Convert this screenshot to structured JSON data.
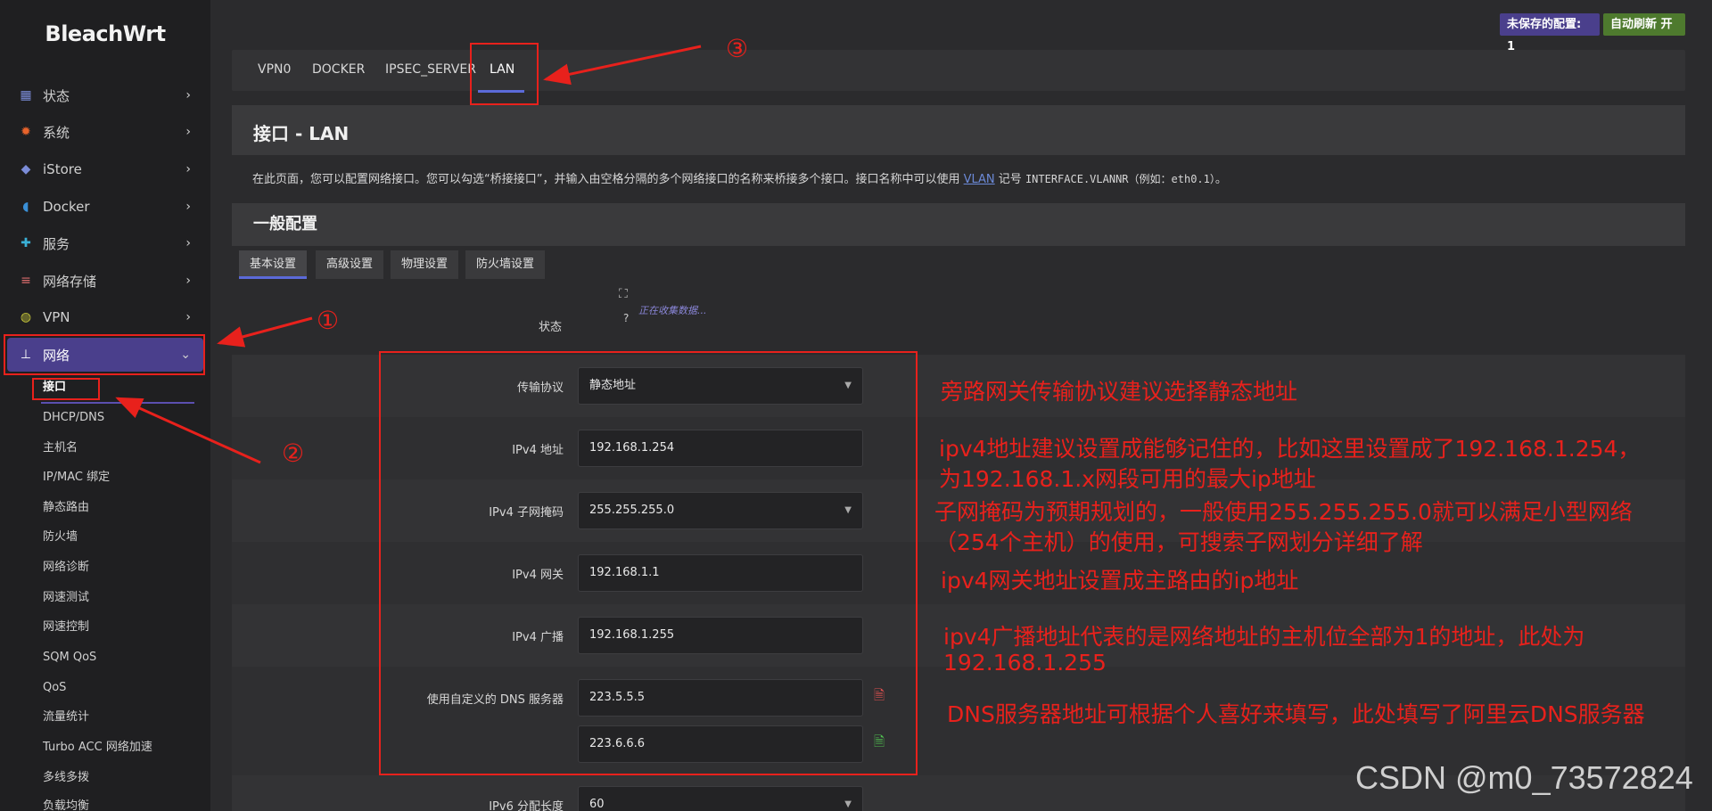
{
  "brand": "BleachWrt",
  "badges": {
    "unsaved": "未保存的配置: 1",
    "refresh": "自动刷新 开"
  },
  "sidebar": {
    "items": [
      {
        "label": "状态",
        "icon": "dashboard-icon"
      },
      {
        "label": "系统",
        "icon": "gear-icon"
      },
      {
        "label": "iStore",
        "icon": "cube-icon"
      },
      {
        "label": "Docker",
        "icon": "docker-icon"
      },
      {
        "label": "服务",
        "icon": "puzzle-icon"
      },
      {
        "label": "网络存储",
        "icon": "database-icon"
      },
      {
        "label": "VPN",
        "icon": "vpn-icon"
      },
      {
        "label": "网络",
        "icon": "network-icon"
      }
    ],
    "subitems": [
      "接口",
      "DHCP/DNS",
      "主机名",
      "IP/MAC 绑定",
      "静态路由",
      "防火墙",
      "网络诊断",
      "网速测试",
      "网速控制",
      "SQM QoS",
      "QoS",
      "流量统计",
      "Turbo ACC 网络加速",
      "多线多拨",
      "负载均衡"
    ]
  },
  "tabs": [
    "VPN0",
    "DOCKER",
    "IPSEC_SERVER",
    "LAN"
  ],
  "page": {
    "title": "接口 - LAN",
    "desc_pre": "在此页面，您可以配置网络接口。您可以勾选“桥接接口”，并输入由空格分隔的多个网络接口的名称来桥接多个接口。接口名称中可以使用 ",
    "desc_link": "VLAN",
    "desc_mid": " 记号 ",
    "desc_code": "INTERFACE.VLANNR（例如：eth0.1）",
    "desc_post": "。",
    "section": "一般配置",
    "subtabs": [
      "基本设置",
      "高级设置",
      "物理设置",
      "防火墙设置"
    ]
  },
  "form": {
    "status_label": "状态",
    "status_q": "?",
    "status_text": "正在收集数据...",
    "protocol_label": "传输协议",
    "protocol_value": "静态地址",
    "ipv4_label": "IPv4 地址",
    "ipv4_value": "192.168.1.254",
    "netmask_label": "IPv4 子网掩码",
    "netmask_value": "255.255.255.0",
    "gateway_label": "IPv4 网关",
    "gateway_value": "192.168.1.1",
    "broadcast_label": "IPv4 广播",
    "broadcast_value": "192.168.1.255",
    "dns_label": "使用自定义的 DNS 服务器",
    "dns1": "223.5.5.5",
    "dns2": "223.6.6.6",
    "ipv6_label": "IPv6 分配长度",
    "ipv6_value": "60"
  },
  "annotations": {
    "n1": "①",
    "n2": "②",
    "n3": "③",
    "a1": "旁路网关传输协议建议选择静态地址",
    "a2a": "ipv4地址建议设置成能够记住的，比如这里设置成了192.168.1.254，",
    "a2b": "为192.168.1.x网段可用的最大ip地址",
    "a3a": "子网掩码为预期规划的，一般使用255.255.255.0就可以满足小型网络",
    "a3b": "（254个主机）的使用，可搜索子网划分详细了解",
    "a4": "ipv4网关地址设置成主路由的ip地址",
    "a5a": "ipv4广播地址代表的是网络地址的主机位全部为1的地址，此处为",
    "a5b": "192.168.1.255",
    "a6": "DNS服务器地址可根据个人喜好来填写，此处填写了阿里云DNS服务器"
  },
  "watermark": "CSDN @m0_73572824",
  "colors": {
    "accent": "#4a3f8c",
    "annotation": "#e8211c",
    "tab_underline": "#5b6ad9"
  }
}
